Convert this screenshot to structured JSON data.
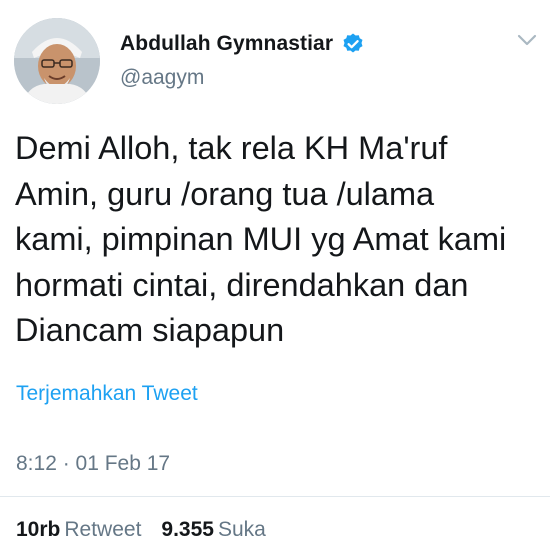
{
  "tweet": {
    "author_name": "Abdullah Gymnastiar",
    "handle": "@aagym",
    "verified_icon": "verified-badge-icon",
    "text": "Demi Alloh, tak rela KH Ma'ruf\nAmin, guru /orang tua /ulama\nkami, pimpinan MUI yg Amat kami\nhormati cintai, direndahkan dan\nDiancam siapapun",
    "translate_label": "Terjemahkan Tweet",
    "timestamp": "8:12 · 01 Feb 17",
    "stats": {
      "retweets_count": "10rb",
      "retweets_label": "Retweet",
      "likes_count": "9.355",
      "likes_label": "Suka"
    }
  },
  "colors": {
    "accent": "#1da1f2",
    "text_primary": "#14171a",
    "text_secondary": "#657786"
  }
}
